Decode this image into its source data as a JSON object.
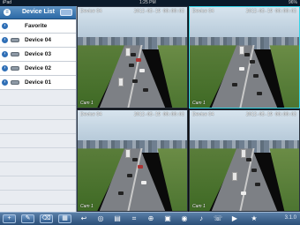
{
  "status_bar": {
    "left": "iPad",
    "center": "1:25 PM",
    "right": "96%"
  },
  "sidebar": {
    "title": "Device List",
    "items": [
      {
        "label": "Favorite"
      },
      {
        "label": "Device 04"
      },
      {
        "label": "Device 03"
      },
      {
        "label": "Device 02"
      },
      {
        "label": "Device 01"
      }
    ]
  },
  "tiles": [
    {
      "label": "Device 04",
      "timestamp": "2012-05-19 00:00:03",
      "channel": "Cam 1"
    },
    {
      "label": "Device 04",
      "timestamp": "2012-05-19 00:00:03",
      "channel": "Cam 1"
    },
    {
      "label": "Device 04",
      "timestamp": "2012-05-19 00:00:03",
      "channel": "Cam 1"
    },
    {
      "label": "Device 04",
      "timestamp": "2012-05-19 00:00:03",
      "channel": "Cam 1"
    }
  ],
  "bottom_bar": {
    "left_buttons": [
      {
        "icon": "add-icon",
        "glyph": "+"
      },
      {
        "icon": "edit-icon",
        "glyph": "✎"
      },
      {
        "icon": "delete-icon",
        "glyph": "⌫"
      },
      {
        "icon": "grid-icon",
        "glyph": "▦"
      }
    ],
    "toolbar_icons": [
      {
        "icon": "back-icon",
        "glyph": "↩"
      },
      {
        "icon": "ptz-icon",
        "glyph": "◎"
      },
      {
        "icon": "layout-icon",
        "glyph": "▤"
      },
      {
        "icon": "crop-icon",
        "glyph": "⌗"
      },
      {
        "icon": "zoom-icon",
        "glyph": "⊕"
      },
      {
        "icon": "record-icon",
        "glyph": "▣"
      },
      {
        "icon": "snapshot-icon",
        "glyph": "◉"
      },
      {
        "icon": "audio-icon",
        "glyph": "♪"
      },
      {
        "icon": "talk-icon",
        "glyph": "☏"
      },
      {
        "icon": "playback-icon",
        "glyph": "▶"
      },
      {
        "icon": "favorite-icon",
        "glyph": "★"
      }
    ],
    "version": "3.1.0"
  }
}
